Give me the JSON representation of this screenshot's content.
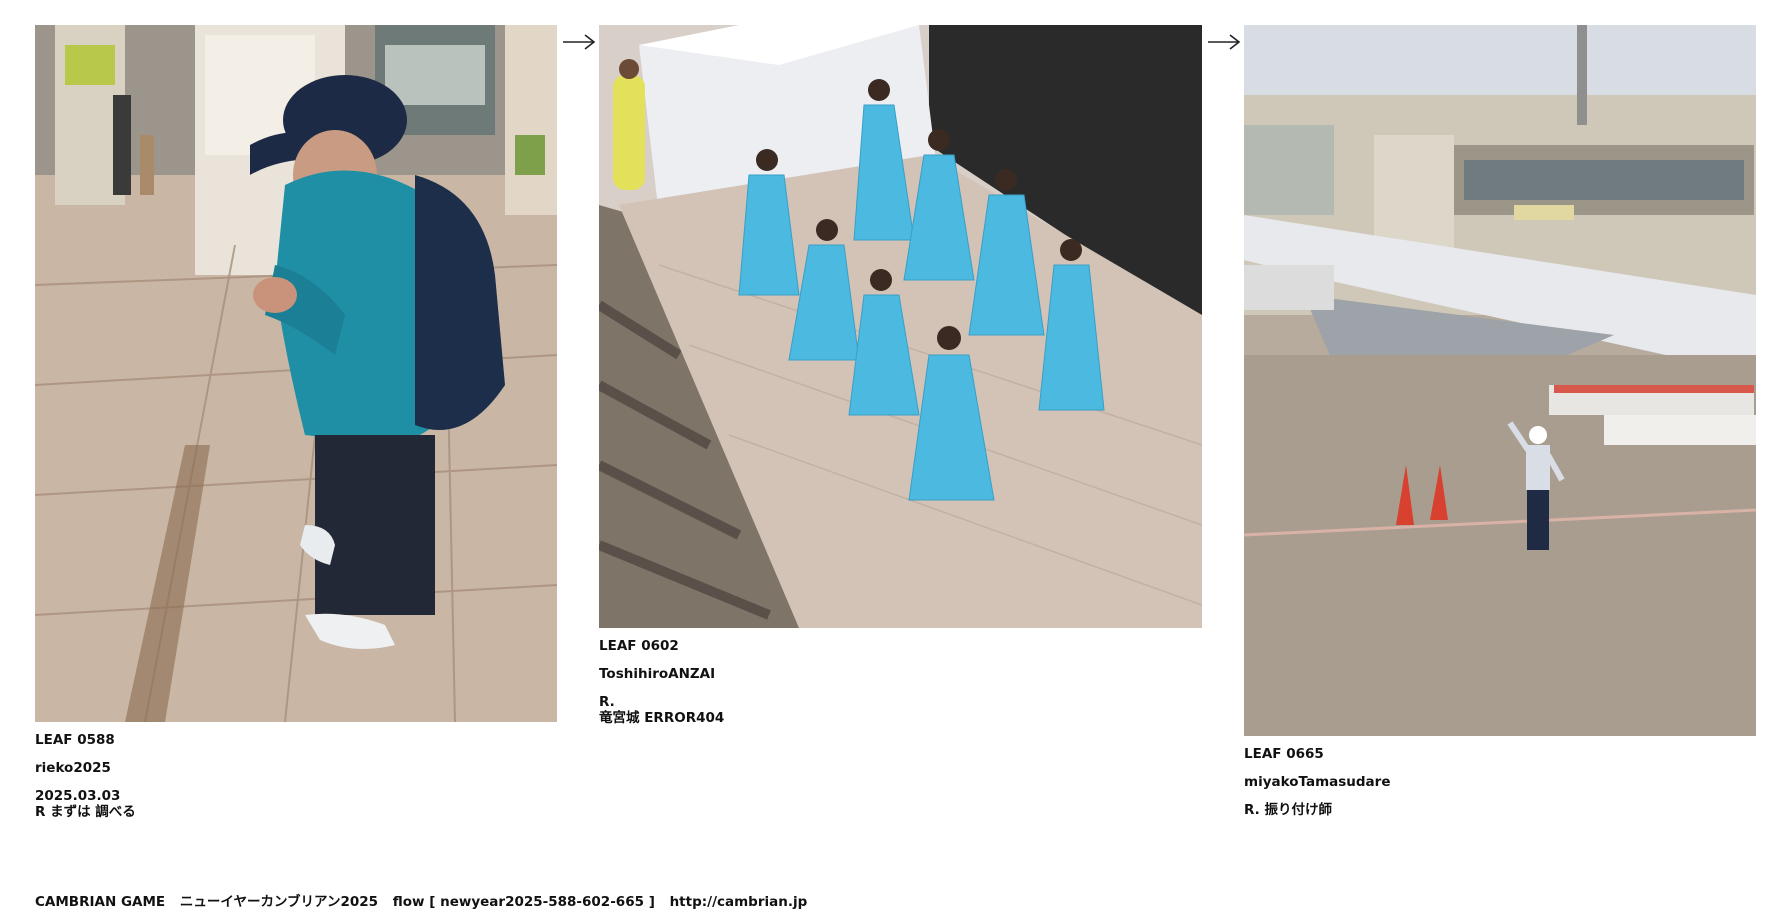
{
  "leaves": [
    {
      "photo_name": "photo-man-in-station",
      "id_label": "LEAF 0588",
      "author": "rieko2025",
      "line3": "2025.03.03",
      "line4": "R まずは 調べる"
    },
    {
      "photo_name": "photo-hula-dancers",
      "id_label": "LEAF 0602",
      "author": "ToshihiroANZAI",
      "line3": "R.",
      "line4": "竜宮城 ERROR404"
    },
    {
      "photo_name": "photo-airport-marshaller",
      "id_label": "LEAF 0665",
      "author": "miyakoTamasudare",
      "line3": "R.  振り付け師"
    }
  ],
  "arrows": [
    "→",
    "→"
  ],
  "footer": {
    "title": "CAMBRIAN GAME",
    "event": "ニューイヤーカンブリアン2025",
    "flow": "flow [ newyear2025-588-602-665 ]",
    "url": "http://cambrian.jp"
  }
}
